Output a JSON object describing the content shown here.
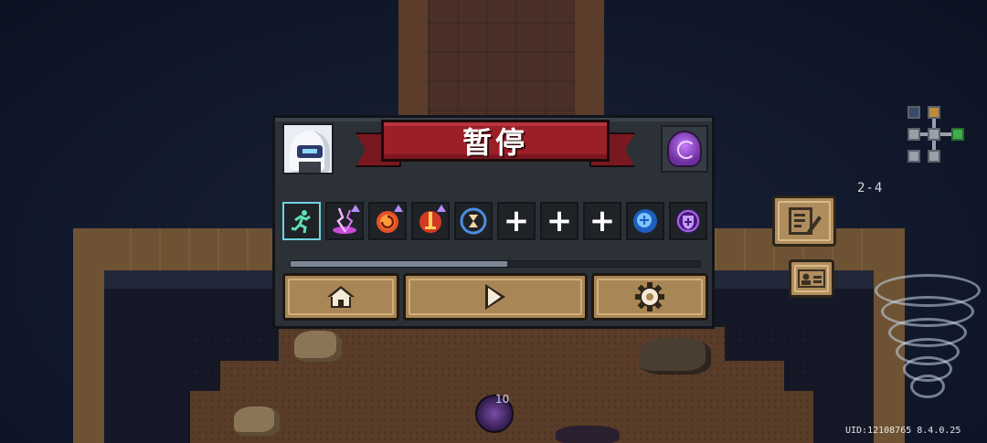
{
  "pause_menu": {
    "title": "暂停",
    "character_portrait": "hooded-knight-portrait",
    "pet_icon": "purple-swirl-pet-icon",
    "buffs": [
      {
        "icon": "running-figure-icon",
        "selected": true,
        "upgraded": false
      },
      {
        "icon": "lightning-burst-icon",
        "selected": false,
        "upgraded": true
      },
      {
        "icon": "fire-swirl-icon",
        "selected": false,
        "upgraded": true
      },
      {
        "icon": "flame-sword-icon",
        "selected": false,
        "upgraded": true
      },
      {
        "icon": "hourglass-icon",
        "selected": false,
        "upgraded": false
      },
      {
        "icon": "plus-icon",
        "label": "+",
        "selected": false,
        "upgraded": false
      },
      {
        "icon": "plus-icon",
        "label": "+",
        "selected": false,
        "upgraded": false
      },
      {
        "icon": "plus-icon",
        "label": "+",
        "selected": false,
        "upgraded": false
      },
      {
        "icon": "brain-plus-icon",
        "selected": false,
        "upgraded": false
      },
      {
        "icon": "shield-badge-icon",
        "selected": false,
        "upgraded": false
      }
    ],
    "progress_fraction": 0.53,
    "buttons": [
      {
        "icon": "home-icon"
      },
      {
        "icon": "play-icon"
      },
      {
        "icon": "gear-icon"
      }
    ]
  },
  "hud": {
    "level": "2-4",
    "uid_text": "UID:12108765 8.4.0.25",
    "orb_count": "10"
  },
  "colors": {
    "ribbon_red": "#9b1f27",
    "button_tan": "#a88656",
    "panel_bg": "#2c3138",
    "selected_outline": "#6fd3e0"
  }
}
